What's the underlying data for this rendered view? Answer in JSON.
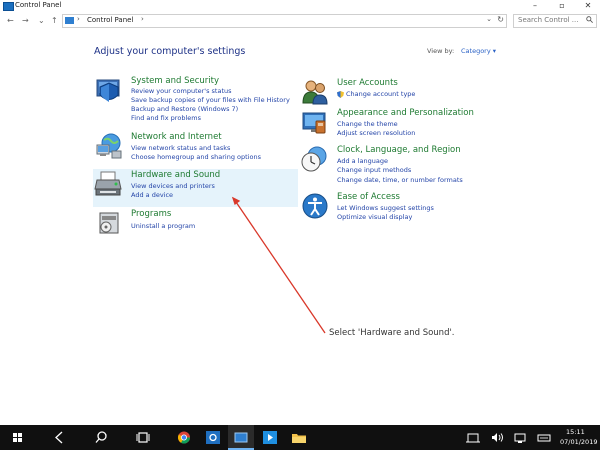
{
  "window": {
    "title": "Control Panel",
    "min_glyph": "–",
    "max_glyph": "▫",
    "close_glyph": "✕"
  },
  "nav": {
    "back_glyph": "←",
    "forward_glyph": "→",
    "recent_glyph": "⌄",
    "up_glyph": "↑",
    "address_sep": "›",
    "address_path": "Control Panel",
    "address_sep2": "›",
    "address_dropdown": "⌄",
    "refresh_glyph": "↻",
    "search_placeholder": "Search Control ..."
  },
  "header": {
    "title": "Adjust your computer's settings",
    "view_by_label": "View by:",
    "view_by_value": "Category ▾"
  },
  "left_categories": [
    {
      "title": "System and Security",
      "links": [
        "Review your computer's status",
        "Save backup copies of your files with File History",
        "Backup and Restore (Windows 7)",
        "Find and fix problems"
      ],
      "icon": "shield-icon"
    },
    {
      "title": "Network and Internet",
      "links": [
        "View network status and tasks",
        "Choose homegroup and sharing options"
      ],
      "icon": "network-icon"
    },
    {
      "title": "Hardware and Sound",
      "links": [
        "View devices and printers",
        "Add a device"
      ],
      "icon": "printer-icon"
    },
    {
      "title": "Programs",
      "links": [
        "Uninstall a program"
      ],
      "icon": "programs-icon"
    }
  ],
  "right_categories": [
    {
      "title": "User Accounts",
      "links": [
        "Change account type"
      ],
      "icon": "users-icon"
    },
    {
      "title": "Appearance and Personalization",
      "links": [
        "Change the theme",
        "Adjust screen resolution"
      ],
      "icon": "appearance-icon"
    },
    {
      "title": "Clock, Language, and Region",
      "links": [
        "Add a language",
        "Change input methods",
        "Change date, time, or number formats"
      ],
      "icon": "clock-icon"
    },
    {
      "title": "Ease of Access",
      "links": [
        "Let Windows suggest settings",
        "Optimize visual display"
      ],
      "icon": "ease-of-access-icon"
    }
  ],
  "annotation": {
    "text": "Select 'Hardware and Sound'."
  },
  "taskbar": {
    "time": "15:11",
    "date": "07/01/2019"
  },
  "colors": {
    "heading": "#1e3287",
    "category_title": "#1e7a31",
    "link": "#2445a8",
    "highlight": "#e5f3fb",
    "arrow": "#d9382a",
    "taskbar": "#101010"
  }
}
